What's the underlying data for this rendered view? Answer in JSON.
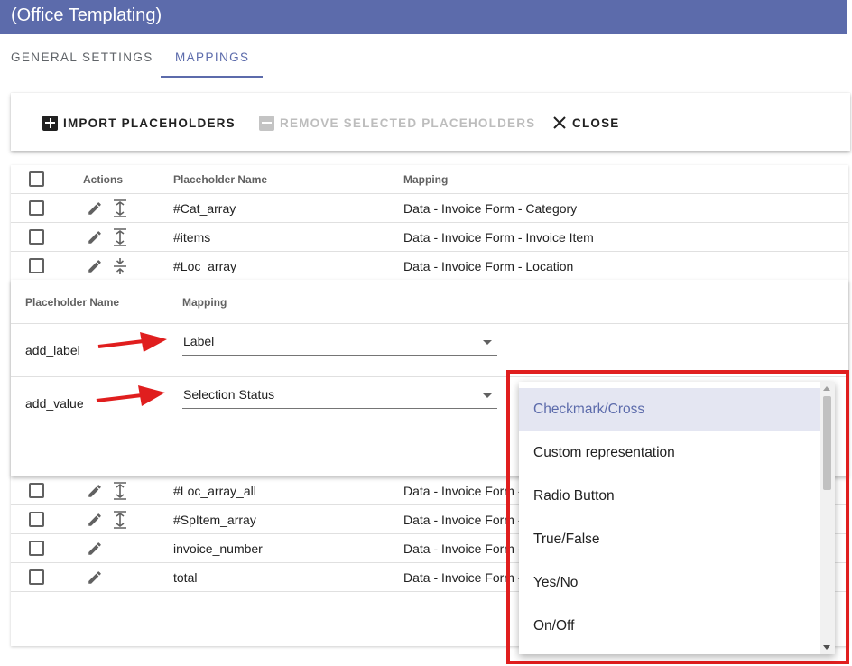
{
  "app": {
    "title": "(Office Templating)"
  },
  "tabs": [
    {
      "label": "GENERAL SETTINGS",
      "active": false
    },
    {
      "label": "MAPPINGS",
      "active": true
    }
  ],
  "toolbar": {
    "import_label": "IMPORT PLACEHOLDERS",
    "remove_label": "REMOVE SELECTED PLACEHOLDERS",
    "close_label": "CLOSE"
  },
  "table": {
    "headers": {
      "actions": "Actions",
      "name": "Placeholder Name",
      "mapping": "Mapping"
    },
    "rows_top": [
      {
        "name": "#Cat_array",
        "mapping": "Data - Invoice Form - Category",
        "expand": "expand"
      },
      {
        "name": "#items",
        "mapping": "Data - Invoice Form - Invoice Item",
        "expand": "expand"
      },
      {
        "name": "#Loc_array",
        "mapping": "Data - Invoice Form - Location",
        "expand": "collapse"
      }
    ],
    "rows_bottom": [
      {
        "name": "#Loc_array_all",
        "mapping": "Data - Invoice Form -",
        "expand": "expand"
      },
      {
        "name": "#SpItem_array",
        "mapping": "Data - Invoice Form -",
        "expand": "expand"
      },
      {
        "name": "invoice_number",
        "mapping": "Data - Invoice Form -",
        "expand": ""
      },
      {
        "name": "total",
        "mapping": "Data - Invoice Form -",
        "expand": ""
      }
    ]
  },
  "sub_table": {
    "headers": {
      "name": "Placeholder Name",
      "mapping": "Mapping"
    },
    "rows": [
      {
        "name": "add_label",
        "mapping": "Label"
      },
      {
        "name": "add_value",
        "mapping": "Selection Status"
      }
    ]
  },
  "dropdown": {
    "options": [
      {
        "label": "Checkmark/Cross",
        "selected": true
      },
      {
        "label": "Custom representation",
        "selected": false
      },
      {
        "label": "Radio Button",
        "selected": false
      },
      {
        "label": "True/False",
        "selected": false
      },
      {
        "label": "Yes/No",
        "selected": false
      },
      {
        "label": "On/Off",
        "selected": false
      }
    ]
  },
  "colors": {
    "primary": "#5c6bab",
    "highlight": "#e01e1e",
    "selected_bg": "#e4e6f2"
  },
  "icons": [
    "plus-box-icon",
    "minus-box-icon",
    "close-icon",
    "pencil-icon",
    "expand-icon",
    "collapse-icon",
    "checkbox-icon",
    "arrow-icon",
    "chevron-down-icon"
  ]
}
